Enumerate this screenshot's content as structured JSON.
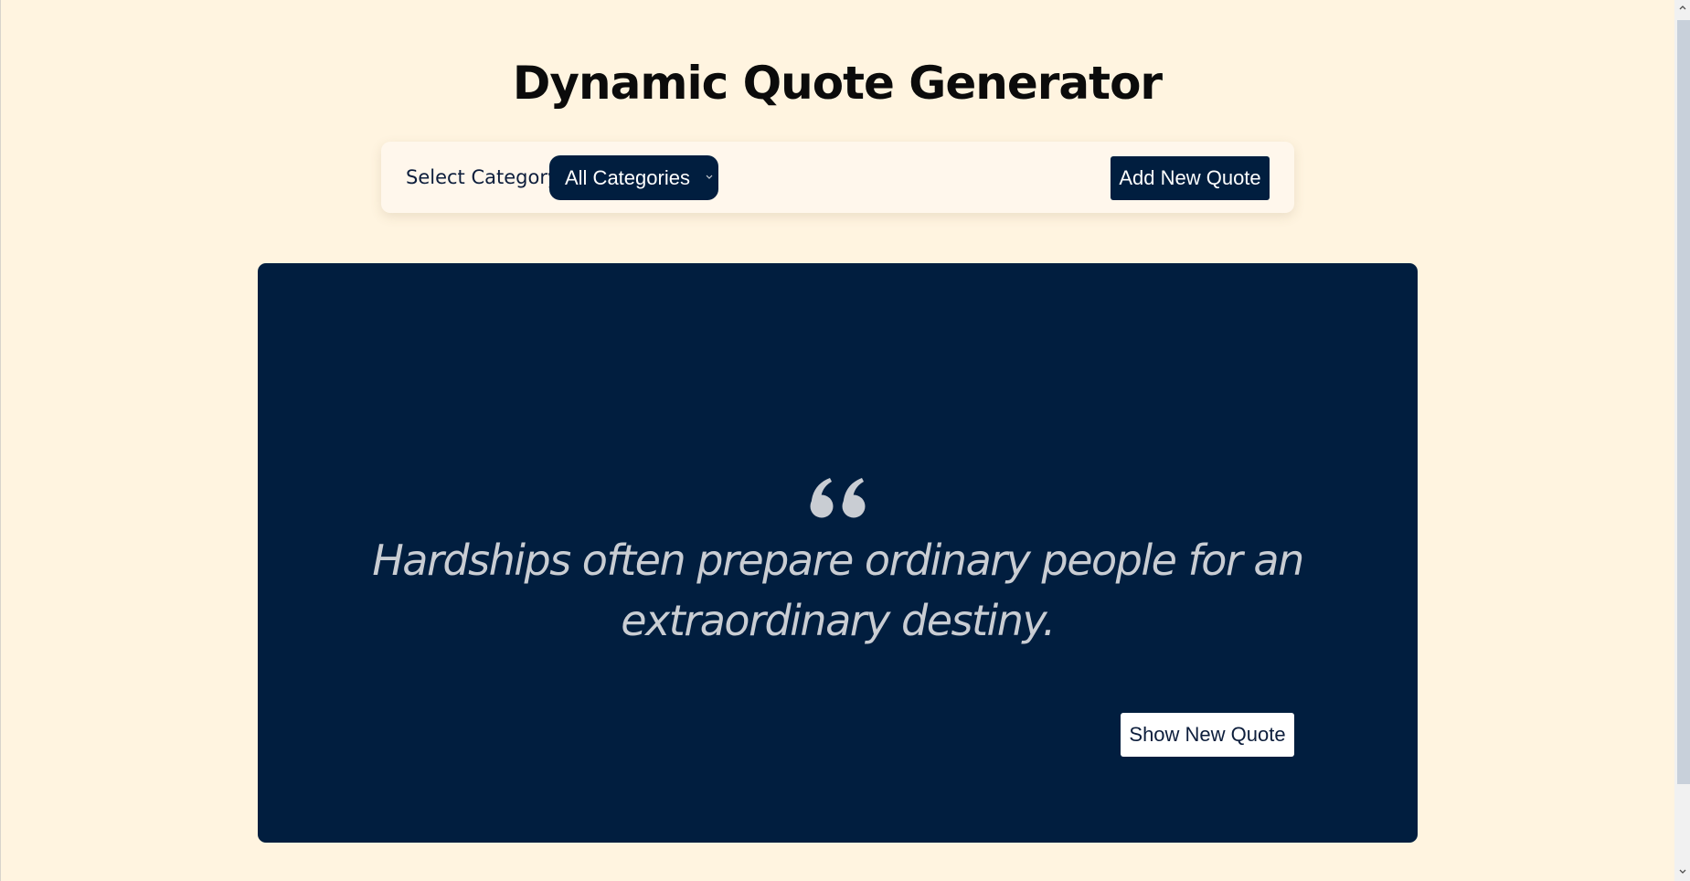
{
  "header": {
    "title": "Dynamic Quote Generator"
  },
  "toolbar": {
    "category_label": "Select Category",
    "category_select": {
      "selected": "All Categories"
    },
    "add_button_label": "Add New Quote"
  },
  "quote": {
    "icon": "quote-left-icon",
    "text": "Hardships often prepare ordinary people for an extraordinary destiny.",
    "show_button_label": "Show New Quote"
  },
  "colors": {
    "background": "#fff4e0",
    "accent": "#011e3f",
    "quote_text": "#c9cdd3"
  }
}
